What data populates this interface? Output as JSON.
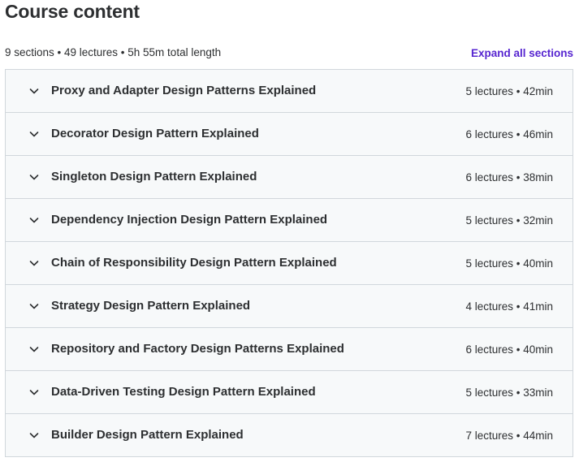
{
  "header": {
    "title": "Course content",
    "summary": "9 sections • 49 lectures • 5h 55m total length",
    "expand_all_label": "Expand all sections"
  },
  "sections": [
    {
      "title": "Proxy and Adapter Design Patterns Explained",
      "meta": "5 lectures • 42min"
    },
    {
      "title": "Decorator Design Pattern Explained",
      "meta": "6 lectures • 46min"
    },
    {
      "title": "Singleton Design Pattern Explained",
      "meta": "6 lectures • 38min"
    },
    {
      "title": "Dependency Injection Design Pattern Explained",
      "meta": "5 lectures • 32min"
    },
    {
      "title": "Chain of Responsibility Design Pattern Explained",
      "meta": "5 lectures • 40min"
    },
    {
      "title": "Strategy Design Pattern Explained",
      "meta": "4 lectures • 41min"
    },
    {
      "title": "Repository and Factory Design Patterns Explained",
      "meta": "6 lectures • 40min"
    },
    {
      "title": "Data-Driven Testing Design Pattern Explained",
      "meta": "5 lectures • 33min"
    },
    {
      "title": "Builder Design Pattern Explained",
      "meta": "7 lectures • 44min"
    }
  ],
  "icons": {
    "section_toggle": "chevron-down-icon"
  },
  "colors": {
    "accent": "#5624d0",
    "section_bg": "#f7f9fa",
    "border": "#d1d7dc",
    "text": "#2d2f31"
  }
}
